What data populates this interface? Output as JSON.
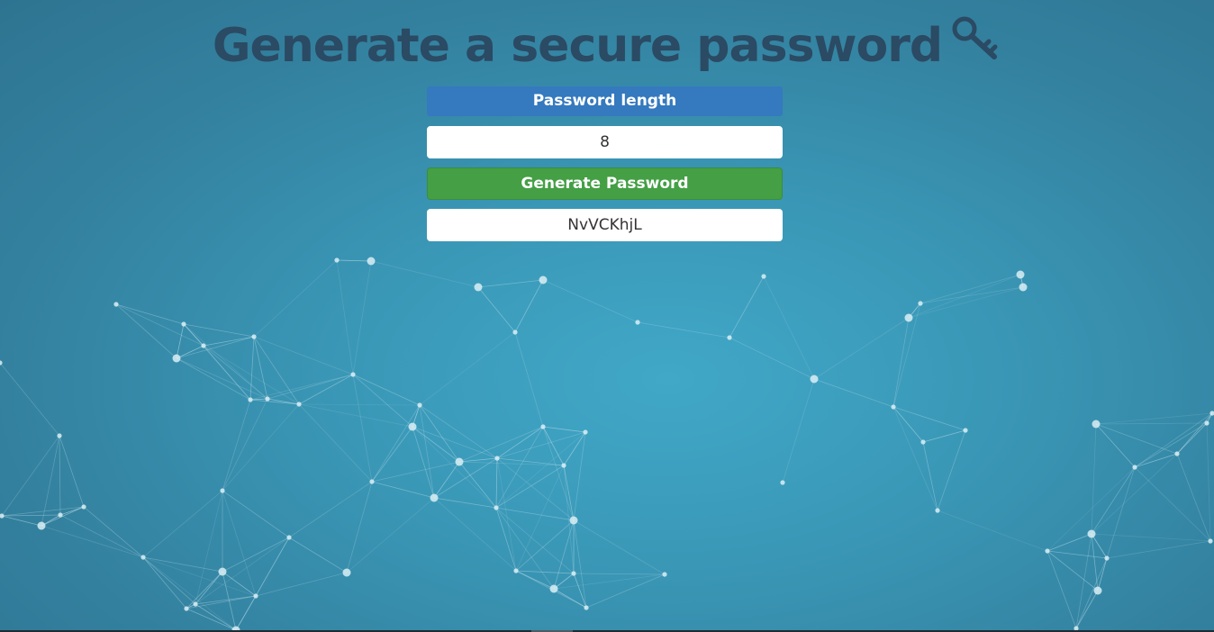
{
  "header": {
    "title": "Generate a secure password",
    "title_icon": "key-icon"
  },
  "form": {
    "length_label": "Password length",
    "length_value": "8",
    "generate_label": "Generate Password",
    "generated_password": "NvVCKhjL"
  },
  "colors": {
    "background": "#3a97b6",
    "title": "#2b4a63",
    "label_bar": "#3579be",
    "generate_button": "#449f45",
    "network_lines": "#bcdce8"
  }
}
